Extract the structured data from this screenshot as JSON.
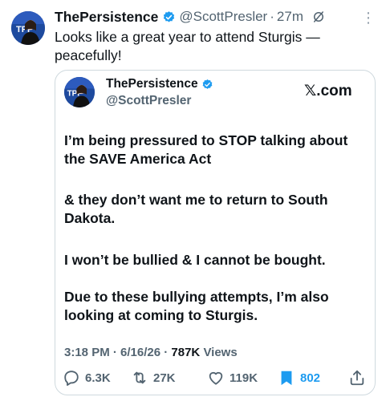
{
  "tweet": {
    "author_name": "ThePersistence",
    "handle": "@ScottPresler",
    "separator": "·",
    "time": "27m",
    "text": "Looks like a great year to attend Sturgis — peacefully!"
  },
  "quoted": {
    "author_name": "ThePersistence",
    "handle": "@ScottPresler",
    "brand": "𝕏.com",
    "paragraphs": [
      "I’m being pressured to STOP talking about the SAVE America Act",
      "& they don’t want me to return to South Dakota.",
      "I won’t be bullied & I cannot be bought.",
      "Due to these bullying attempts, I’m also looking at coming to Sturgis."
    ],
    "meta_prefix": "3:18 PM · 6/16/26 · ",
    "views_count": "787K",
    "views_label": "Views",
    "actions": {
      "replies": "6.3K",
      "retweets": "27K",
      "likes": "119K",
      "bookmarks": "802"
    }
  },
  "colors": {
    "accent": "#1d9bf0",
    "muted": "#536471",
    "text": "#0f1419",
    "border": "#cfd9de"
  },
  "icons": [
    "verified-badge-icon",
    "grok-icon",
    "more-icon",
    "reply-icon",
    "retweet-icon",
    "like-icon",
    "bookmark-icon",
    "share-icon"
  ]
}
